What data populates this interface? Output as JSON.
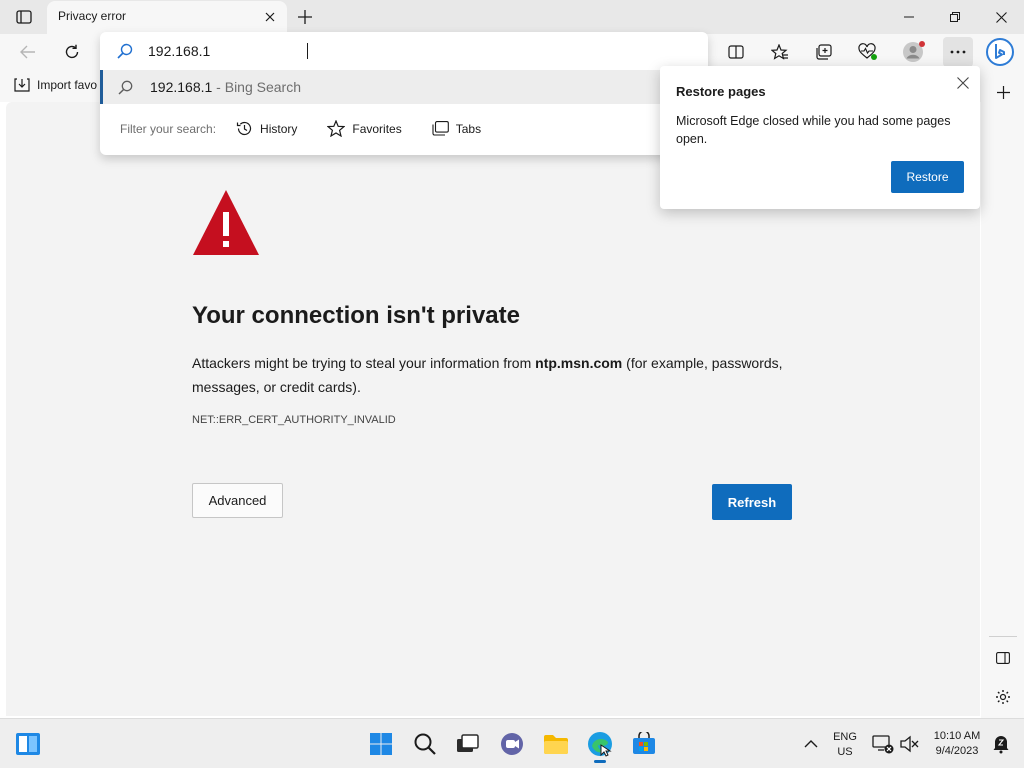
{
  "tab": {
    "title": "Privacy error"
  },
  "address": {
    "value": "192.168.1"
  },
  "suggestion": {
    "text": "192.168.1",
    "suffix": " - Bing Search"
  },
  "filter": {
    "label": "Filter your search:",
    "history": "History",
    "favorites": "Favorites",
    "tabs": "Tabs"
  },
  "favbar": {
    "import_label": "Import favo"
  },
  "restore": {
    "title": "Restore pages",
    "message": "Microsoft Edge closed while you had some pages open.",
    "button": "Restore"
  },
  "error_page": {
    "headline": "Your connection isn't private",
    "desc_before": "Attackers might be trying to steal your information from ",
    "desc_host": "ntp.msn.com",
    "desc_after": " (for example, passwords, messages, or credit cards).",
    "error_code": "NET::ERR_CERT_AUTHORITY_INVALID",
    "advanced_label": "Advanced",
    "refresh_label": "Refresh"
  },
  "taskbar": {
    "language": "ENG",
    "region": "US",
    "time": "10:10 AM",
    "date": "9/4/2023"
  },
  "colors": {
    "accent": "#0f6cbd",
    "warning_red": "#c50f1f"
  }
}
